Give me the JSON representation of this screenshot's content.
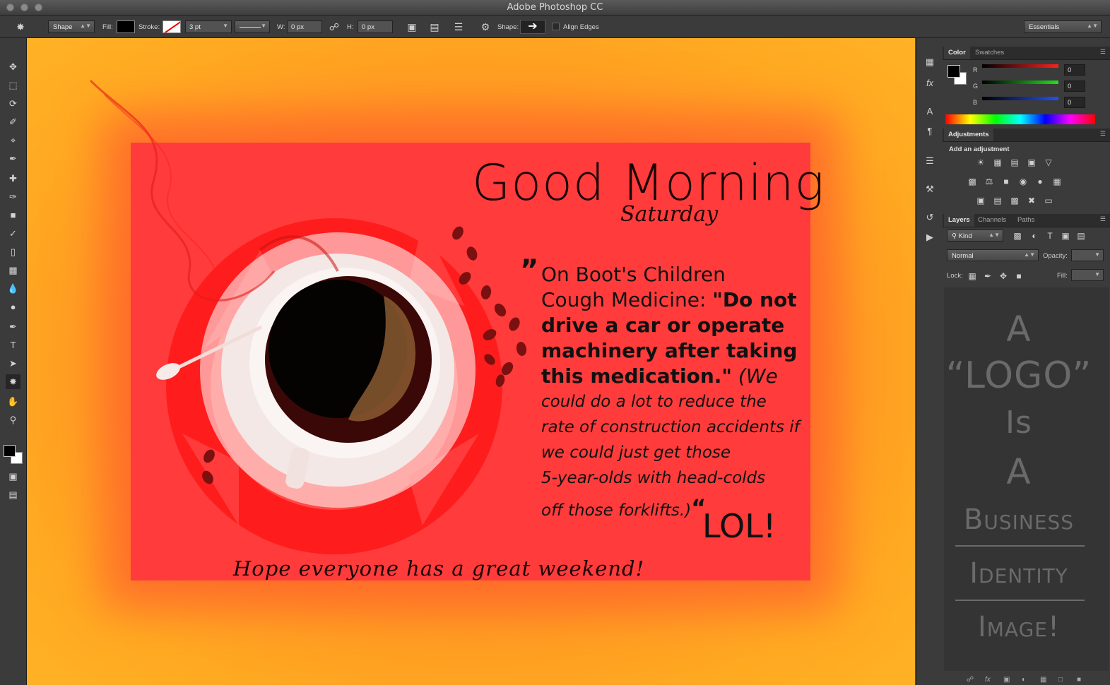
{
  "window": {
    "title": "Adobe Photoshop CC"
  },
  "options_bar": {
    "mode": "Shape",
    "fill_label": "Fill:",
    "stroke_label": "Stroke:",
    "stroke_width": "3 pt",
    "w_label": "W:",
    "w_value": "0 px",
    "h_label": "H:",
    "h_value": "0 px",
    "shape_label": "Shape:",
    "align_edges": "Align Edges",
    "workspace": "Essentials"
  },
  "color_panel": {
    "tabs": [
      "Color",
      "Swatches"
    ],
    "channels": [
      {
        "label": "R",
        "value": "0",
        "color": "#e03030"
      },
      {
        "label": "G",
        "value": "0",
        "color": "#30c030"
      },
      {
        "label": "B",
        "value": "0",
        "color": "#3050e0"
      }
    ]
  },
  "adjustments_panel": {
    "tab": "Adjustments",
    "heading": "Add an adjustment"
  },
  "layers_panel": {
    "tabs": [
      "Layers",
      "Channels",
      "Paths"
    ],
    "filter": "Kind",
    "blend_mode": "Normal",
    "opacity_label": "Opacity:",
    "lock_label": "Lock:",
    "fill_label": "Fill:",
    "overlay_lines": [
      "A",
      "“LOGO”",
      "Is",
      "A",
      "Business",
      "Identity",
      "Image!"
    ]
  },
  "artwork": {
    "greeting": "Good Morning",
    "day": "Saturday",
    "quote_open": "”",
    "quote_line1": "On Boot's Children",
    "quote_line2a": "Cough Medicine: ",
    "quote_line2b": "\"Do not",
    "quote_line3": "drive a car or operate",
    "quote_line4": "machinery after taking",
    "quote_line5a": "this medication.\"",
    "quote_line5b": " (We",
    "quote_line6": "could do a lot to reduce the",
    "quote_line7": "rate of construction accidents if",
    "quote_line8": "we could just get those",
    "quote_line9": "5-year-olds with head-colds",
    "quote_line10": "off those forklifts.)",
    "quote_close": "“",
    "lol": "LOL!",
    "closing": "Hope everyone has a great weekend!"
  },
  "colors": {
    "canvas_orange": "#ff9a22",
    "panel_red": "#ff3b3b",
    "ui_dark": "#3b3b3b"
  }
}
